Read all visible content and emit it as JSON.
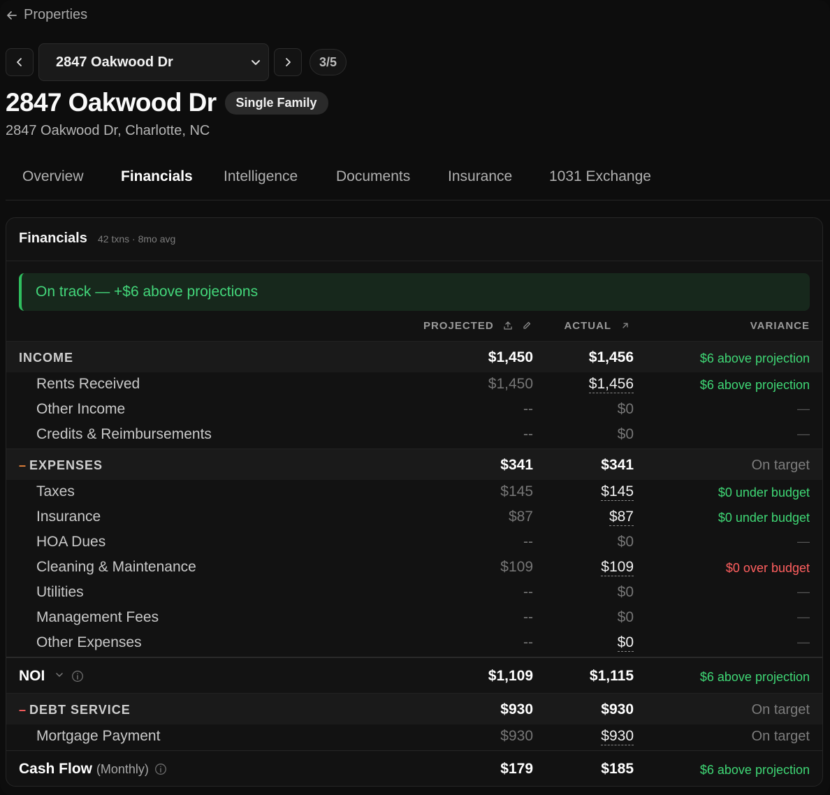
{
  "header": {
    "back_label": "Properties",
    "property_select_value": "2847 Oakwood Dr",
    "counter": "3/5",
    "title": "2847 Oakwood Dr",
    "type_badge": "Single Family",
    "address": "2847 Oakwood Dr, Charlotte, NC"
  },
  "tabs": [
    {
      "label": "Overview",
      "active": false
    },
    {
      "label": "Financials",
      "active": true
    },
    {
      "label": "Intelligence",
      "active": false
    },
    {
      "label": "Documents",
      "active": false
    },
    {
      "label": "Insurance",
      "active": false
    },
    {
      "label": "1031 Exchange",
      "active": false
    }
  ],
  "financials": {
    "title": "Financials",
    "subtitle": "42 txns · 8mo avg",
    "banner": "On track — +$6 above projections",
    "columns": {
      "projected": "PROJECTED",
      "actual": "ACTUAL",
      "variance": "VARIANCE"
    },
    "income": {
      "label": "INCOME",
      "projected": "$1,450",
      "actual": "$1,456",
      "variance": "$6 above projection",
      "rows": [
        {
          "label": "Rents Received",
          "projected": "$1,450",
          "actual": "$1,456",
          "variance": "$6 above projection"
        },
        {
          "label": "Other Income",
          "projected": "--",
          "actual": "$0",
          "variance": "—"
        },
        {
          "label": "Credits & Reimbursements",
          "projected": "--",
          "actual": "$0",
          "variance": "—"
        }
      ]
    },
    "expenses": {
      "dash": "–",
      "label": "EXPENSES",
      "projected": "$341",
      "actual": "$341",
      "variance": "On target",
      "rows": [
        {
          "label": "Taxes",
          "projected": "$145",
          "actual": "$145",
          "variance": "$0 under budget"
        },
        {
          "label": "Insurance",
          "projected": "$87",
          "actual": "$87",
          "variance": "$0 under budget"
        },
        {
          "label": "HOA Dues",
          "projected": "--",
          "actual": "$0",
          "variance": "—"
        },
        {
          "label": "Cleaning & Maintenance",
          "projected": "$109",
          "actual": "$109",
          "variance": "$0 over budget"
        },
        {
          "label": "Utilities",
          "projected": "--",
          "actual": "$0",
          "variance": "—"
        },
        {
          "label": "Management Fees",
          "projected": "--",
          "actual": "$0",
          "variance": "—"
        },
        {
          "label": "Other Expenses",
          "projected": "--",
          "actual": "$0",
          "variance": "—"
        }
      ]
    },
    "noi": {
      "label": "NOI",
      "projected": "$1,109",
      "actual": "$1,115",
      "variance": "$6 above projection"
    },
    "debt_service": {
      "dash": "–",
      "label": "DEBT SERVICE",
      "projected": "$930",
      "actual": "$930",
      "variance": "On target",
      "rows": [
        {
          "label": "Mortgage Payment",
          "projected": "$930",
          "actual": "$930",
          "variance": "On target"
        }
      ]
    },
    "cash_flow": {
      "label": "Cash Flow",
      "period": "(Monthly)",
      "projected": "$179",
      "actual": "$185",
      "variance": "$6 above projection"
    }
  },
  "colors": {
    "positive": "#3fd775",
    "negative": "#ff5f5f",
    "expense_dash": "#e8833a",
    "debt_dash": "#ff5f5f"
  },
  "icons": [
    "arrow-left-icon",
    "chevron-left-icon",
    "chevron-down-icon",
    "chevron-right-icon",
    "upload-icon",
    "pencil-icon",
    "arrow-up-right-icon",
    "info-icon"
  ]
}
